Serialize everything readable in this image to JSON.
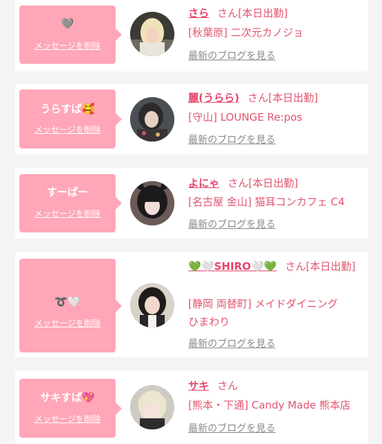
{
  "colors": {
    "accent": "#e8446a",
    "bubble": "#ffa6b8",
    "link_gray": "#8a8a8a",
    "background": "#f4f4f4"
  },
  "common": {
    "delete_label": "メッセージを削除",
    "blog_label": "最新のブログを見る"
  },
  "items": [
    {
      "message": "🩶",
      "name": "さら",
      "suffix": "さん[本日出勤]",
      "shop": "[秋葉原] 二次元カノジョ"
    },
    {
      "message": "うらすぱ🥰",
      "name": "麗(うらら)",
      "suffix": "さん[本日出勤]",
      "shop": "[守山] LOUNGE Re:pos"
    },
    {
      "message": "すーぱー",
      "name": "よにゃ",
      "suffix": "さん[本日出勤]",
      "shop": "[名古屋 金山] 猫耳コンカフェ C4"
    },
    {
      "message": "➰🤍",
      "name": "💚🤍SHIRO🤍💚",
      "suffix": "さん[本日出勤]",
      "shop_line1": "[静岡 両替町] メイドダイニング",
      "shop_line2": "ひまわり"
    },
    {
      "message": "サキすぱ💖",
      "name": "サキ",
      "suffix": "さん",
      "shop": "[熊本・下通] Candy Made 熊本店"
    }
  ]
}
